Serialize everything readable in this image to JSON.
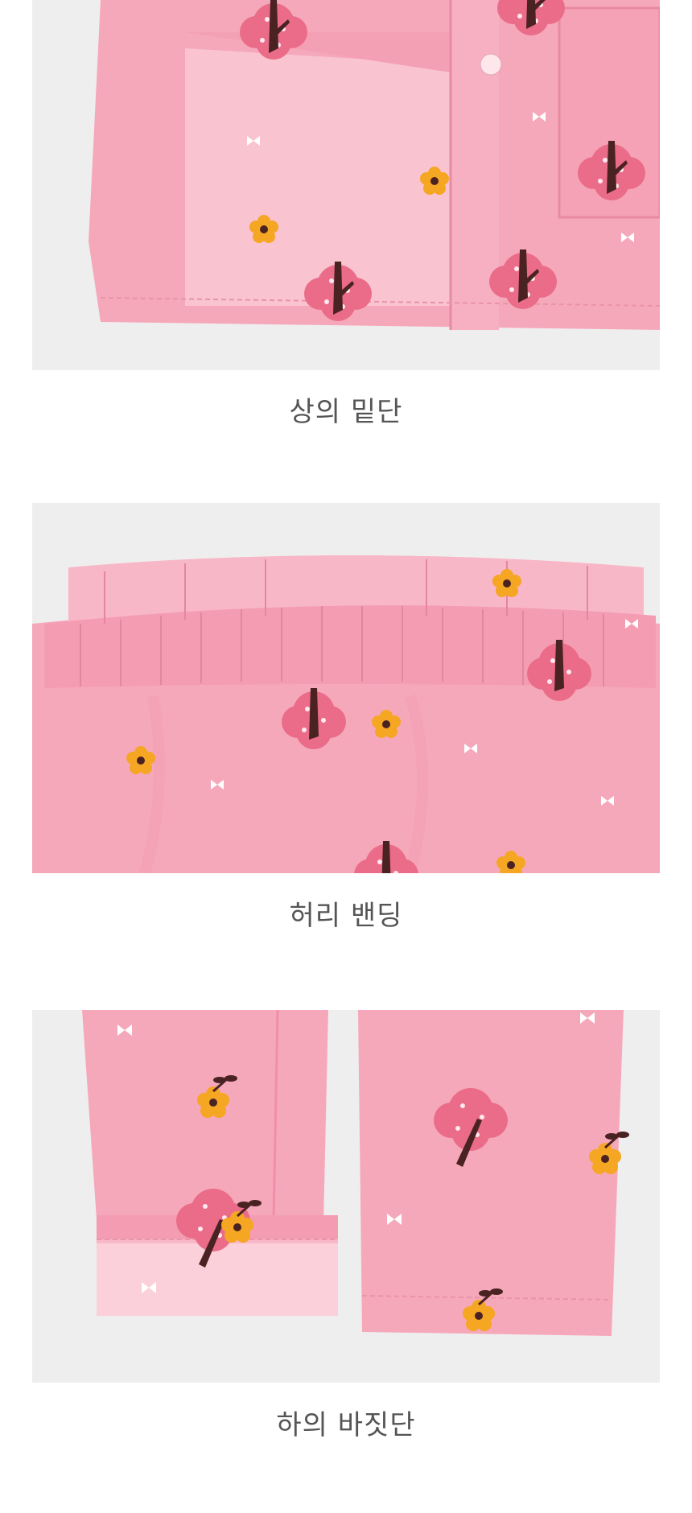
{
  "sections": [
    {
      "caption": "상의 밑단",
      "image": "pink-pajama-top-hem-photo"
    },
    {
      "caption": "허리 밴딩",
      "image": "pink-pajama-waistband-photo"
    },
    {
      "caption": "하의 바짓단",
      "image": "pink-pajama-pant-cuff-photo"
    }
  ],
  "colors": {
    "background": "#ffffff",
    "photo_bg": "#efeeee",
    "fabric": "#f6a8bb",
    "fabric_light": "#f9c3d0",
    "tree_pink": "#ea6c89",
    "trunk": "#4a2222",
    "flower": "#f5a623",
    "caption_text": "#555555"
  }
}
